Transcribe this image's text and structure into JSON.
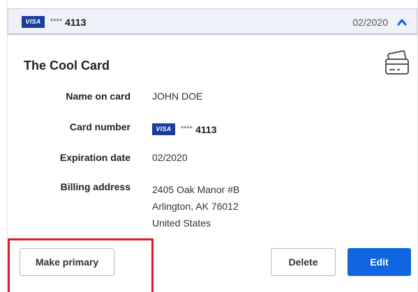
{
  "header": {
    "brand": "VISA",
    "masked_stars": "****",
    "last4": "4113",
    "expiration": "02/2020"
  },
  "card": {
    "title": "The Cool Card",
    "rows": {
      "name_label": "Name on card",
      "name_value": "JOHN DOE",
      "number_label": "Card number",
      "number_brand": "VISA",
      "number_stars": "****",
      "number_last4": "4113",
      "exp_label": "Expiration date",
      "exp_value": "02/2020",
      "address_label": "Billing address",
      "address_line1": "2405 Oak Manor #B",
      "address_line2": "Arlington, AK 76012",
      "address_line3": "United States"
    }
  },
  "actions": {
    "make_primary": "Make primary",
    "delete": "Delete",
    "edit": "Edit"
  },
  "colors": {
    "visa_blue": "#1a3f9a",
    "primary": "#1066e0",
    "highlight": "#e41b23",
    "header_bg": "#eef1f7"
  },
  "icons": {
    "collapse": "chevron-up-icon",
    "card": "credit-card-icon"
  }
}
